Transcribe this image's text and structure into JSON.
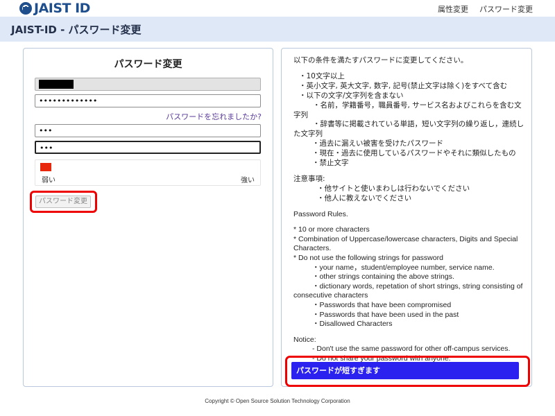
{
  "brand": {
    "logo_text": "JAIST ID"
  },
  "topnav": {
    "attributes": "属性変更",
    "password_change": "パスワード変更"
  },
  "header": {
    "title": "JAIST-ID - パスワード変更"
  },
  "form": {
    "title": "パスワード変更",
    "user_value": "",
    "current_password_value": "•••••••••••••",
    "forgot_link": "パスワードを忘れましたか?",
    "new_password_value": "•••",
    "confirm_password_value": "•••",
    "strength": {
      "weak_label": "弱い",
      "strong_label": "強い",
      "level": 0.05,
      "color": "#e8280d"
    },
    "submit_label": "パスワード変更",
    "submit_enabled": false
  },
  "rules": {
    "intro": "以下の条件を満たすパスワードに変更してください。",
    "items": [
      "・10文字以上",
      "・英小文字, 英大文字, 数字, 記号(禁止文字は除く)をすべて含む",
      "・以下の文字/文字列を含まない",
      "・名前，学籍番号，職員番号, サービス名およびこれらを含む文字列",
      "・辞書等に掲載されている単語，短い文字列の繰り返し，連続した文字列",
      "・過去に漏えい被害を受けたパスワード",
      "・現在・過去に使用しているパスワードやそれに類似したもの",
      "・禁止文字"
    ],
    "notice_title": "注意事項:",
    "notices": [
      "・他サイトと使いまわしは行わないでください",
      "・他人に教えないでください"
    ],
    "en_title": "Password Rules.",
    "en_items": [
      "* 10 or more characters",
      "* Combination of Uppercase/lowercase characters, Digits and Special Characters.",
      "* Do not use the following strings for password",
      "・your name，student/employee number, service name.",
      "・other strings containing the above strings.",
      "・dictionary words, repetation of short strings, string consisting of consecutive characters",
      "・Passwords that have been compromised",
      "・Passwords that have been used in the past",
      "・Disallowed Characters"
    ],
    "en_notice_title": "Notice:",
    "en_notices": [
      "- Don't use the same password for other off-campus services.",
      "- Do not share your password with anyone."
    ]
  },
  "alert": {
    "message": "パスワードが短すぎます",
    "color": "#2b22ef"
  },
  "footer": {
    "copyright": "Copyright © Open Source Solution Technology Corporation"
  }
}
